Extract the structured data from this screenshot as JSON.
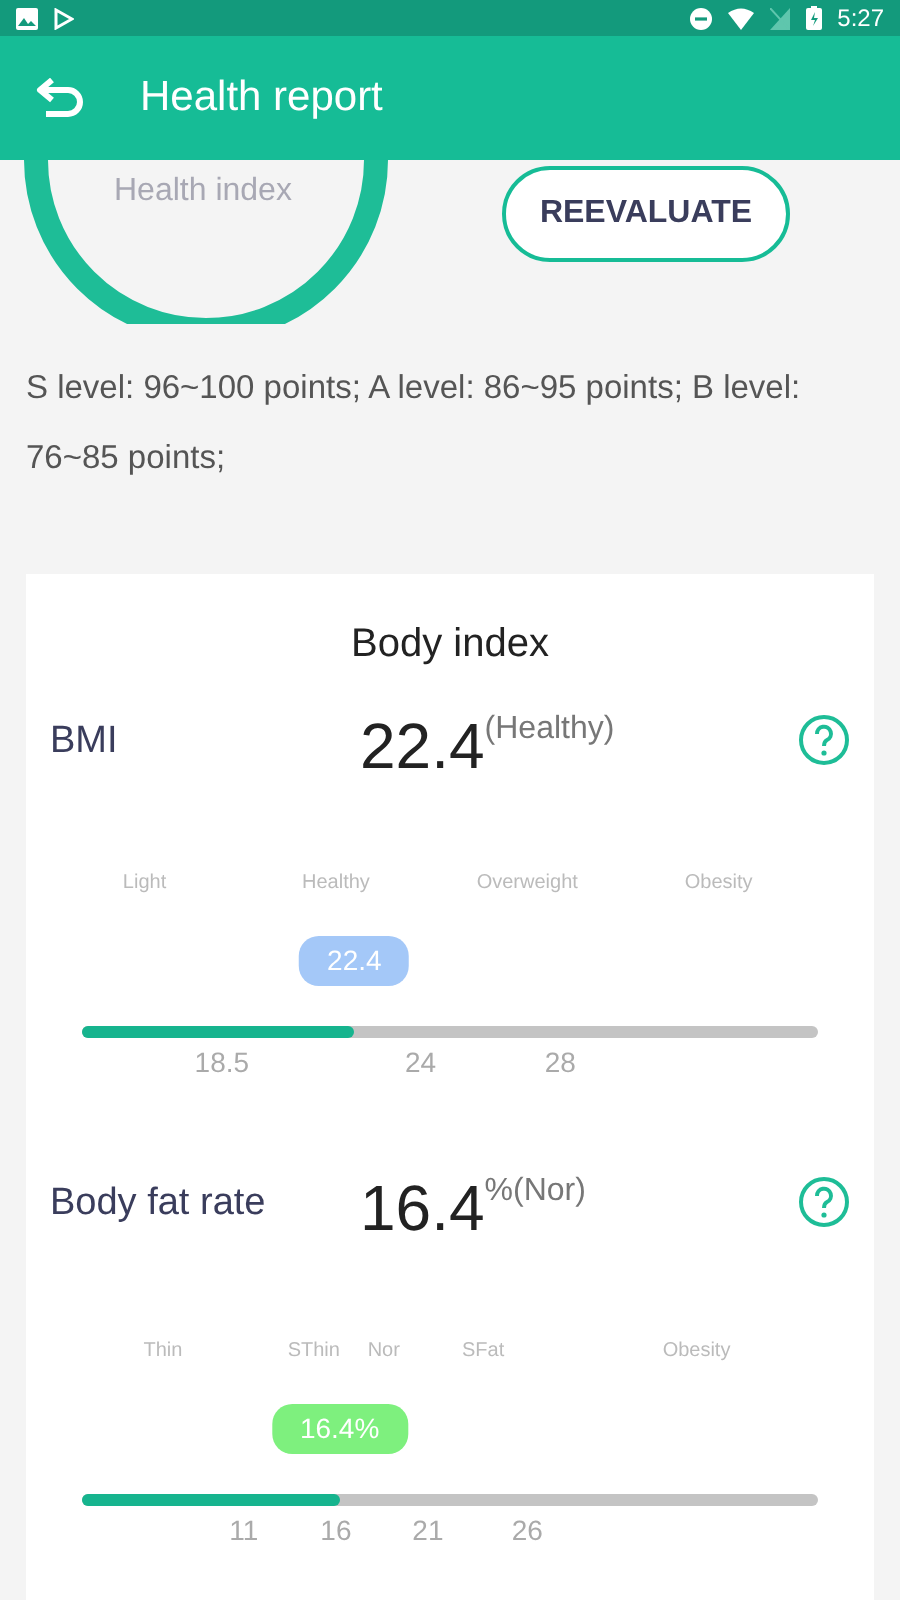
{
  "status_bar": {
    "time": "5:27"
  },
  "app_bar": {
    "title": "Health report"
  },
  "score": {
    "label": "Health index",
    "button": "REEVALUATE"
  },
  "levels_note": "S level: 96~100 points; A level: 86~95 points; B level: 76~85 points;",
  "card": {
    "title": "Body index",
    "metrics": [
      {
        "name": "BMI",
        "value": "22.4",
        "status": "(Healthy)",
        "bubble": "22.4",
        "color": "#a4c8f8",
        "level": 0.37,
        "bands": [
          "Light",
          "Healthy",
          "Overweight",
          "Obesity"
        ],
        "ticks": [
          "18.5",
          "24",
          "28"
        ]
      },
      {
        "name": "Body fat rate",
        "value": "16.4",
        "unit": "%",
        "status": "(Nor)",
        "bubble": "16.4%",
        "color": "#7ef07e",
        "level": 0.35,
        "bands": [
          "Thin",
          "SThin",
          "Nor",
          "SFat",
          "Obesity"
        ],
        "ticks": [
          "11",
          "16",
          "21",
          "26"
        ]
      }
    ]
  }
}
